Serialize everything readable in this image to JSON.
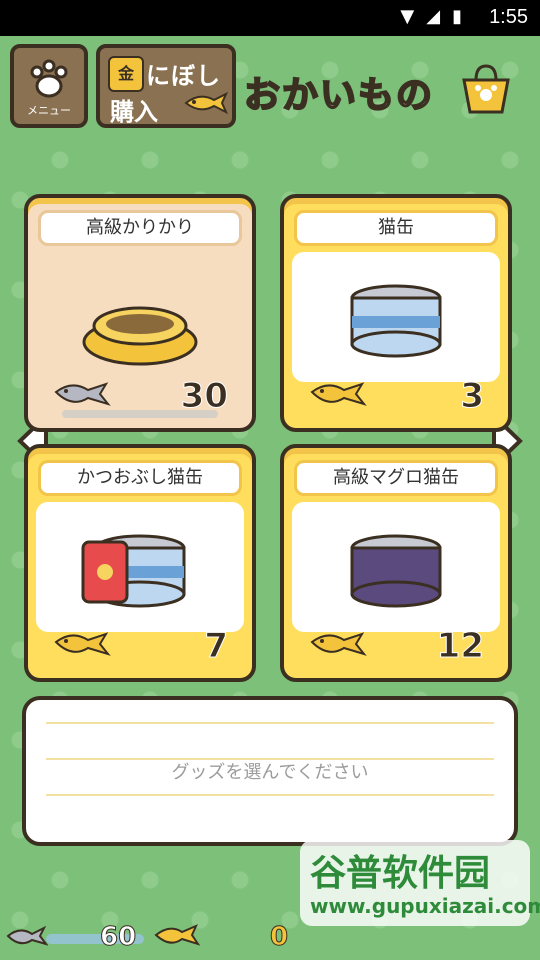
{
  "status": {
    "time": "1:55",
    "icons": [
      "wifi-icon",
      "signal-icon",
      "battery-icon"
    ]
  },
  "header": {
    "menu_label": "メニュー",
    "niboshi_kanji": "金",
    "niboshi_line1": "にぼし",
    "niboshi_line2": "購入",
    "title": "おかいもの"
  },
  "items": [
    {
      "name": "高級かりかり",
      "price": "30",
      "currency": "silver-fish",
      "selected": true,
      "icon": "bowl-icon"
    },
    {
      "name": "猫缶",
      "price": "3",
      "currency": "gold-fish",
      "selected": false,
      "icon": "can-icon-blue"
    },
    {
      "name": "かつおぶし猫缶",
      "price": "7",
      "currency": "gold-fish",
      "selected": false,
      "icon": "can-icon-katsuobushi"
    },
    {
      "name": "高級マグロ猫缶",
      "price": "12",
      "currency": "gold-fish",
      "selected": false,
      "icon": "can-icon-tuna"
    }
  ],
  "message": {
    "prompt": "グッズを選んでください"
  },
  "bottom": {
    "silver_fish": "60",
    "gold_fish": "0"
  },
  "watermark": {
    "title": "谷普软件园",
    "url": "www.gupuxiazai.com"
  },
  "colors": {
    "background": "#7cc07a",
    "card_normal": "#ffde5d",
    "card_selected": "#f6ddc0",
    "outline": "#3b2f22"
  }
}
